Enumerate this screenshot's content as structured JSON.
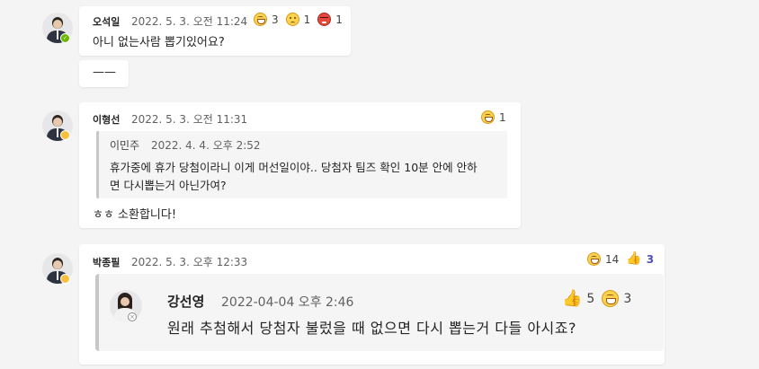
{
  "colors": {
    "background": "#f4f4f5",
    "card": "#ffffff",
    "accent": "#4f52b2"
  },
  "messages": [
    {
      "author": "오석일",
      "time": "2022. 5. 3. 오전 11:24",
      "text": "아니 없는사람 뽑기있어요?",
      "presence": "available",
      "reactions": [
        {
          "icon": "laugh-emoji-icon",
          "count": "3"
        },
        {
          "icon": "sad-emoji-icon",
          "count": "1"
        },
        {
          "icon": "angry-emoji-icon",
          "count": "1"
        }
      ]
    },
    {
      "text": "——"
    },
    {
      "author": "이형선",
      "time": "2022. 5. 3. 오전 11:31",
      "presence": "away",
      "reactions": [
        {
          "icon": "laugh-emoji-icon",
          "count": "1"
        }
      ],
      "quote": {
        "author": "이민주",
        "time": "2022. 4. 4. 오후 2:52",
        "line1": "휴가중에 휴가 당첨이라니 이게 머선일이야.. 당첨자 팀즈 확인 10분 안에 안하",
        "line2": "면 다시뽑는거 아닌가여?"
      },
      "text": "ㅎㅎ 소환합니다!"
    },
    {
      "author": "박종필",
      "time": "2022. 5. 3. 오후 12:33",
      "presence": "away",
      "reactions": [
        {
          "icon": "laugh-emoji-icon",
          "count": "14"
        },
        {
          "icon": "thumbs-up-icon",
          "count": "3"
        }
      ],
      "embed": {
        "author": "강선영",
        "time": "2022-04-04 오후 2:46",
        "text": "원래 추첨해서 당첨자 불렀을 때 없으면 다시 뽑는거 다들 아시죠?",
        "reactions": [
          {
            "icon": "thumbs-up-icon",
            "count": "5"
          },
          {
            "icon": "laugh-emoji-icon",
            "count": "3"
          }
        ]
      }
    }
  ]
}
